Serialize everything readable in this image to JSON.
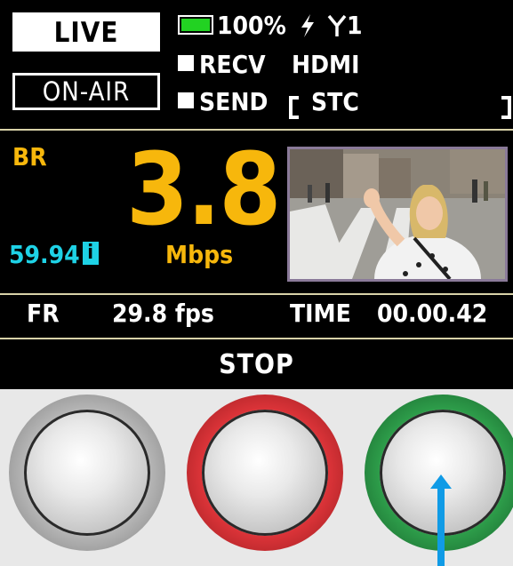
{
  "status": {
    "live_label": "LIVE",
    "onair_label": "ON-AIR",
    "battery": "100%",
    "battery_level": 1.0,
    "power_icon": "lightning-icon",
    "antenna_icon": "antenna-icon",
    "antenna_count": "1",
    "recv_label": "RECV",
    "send_label": "SEND",
    "source": "HDMI",
    "stc_label": "STC"
  },
  "metrics": {
    "br_label": "BR",
    "bitrate_value": "3.8",
    "bitrate_unit": "Mbps",
    "frame_rate_input": "59.94",
    "input_mode_badge": "i",
    "fr_label": "FR",
    "fr_value": "29.8 fps",
    "time_label": "TIME",
    "time_value": "00.00.42"
  },
  "footer": {
    "stop_label": "STOP"
  },
  "colors": {
    "accent_yellow": "#f7b70c",
    "accent_cyan": "#1ed2e6",
    "battery_green": "#22d222",
    "button_gray_ring": "#8a8a8a",
    "button_red_ring": "#c8262a",
    "button_green_ring": "#1f8a3a",
    "arrow_blue": "#109be6"
  }
}
